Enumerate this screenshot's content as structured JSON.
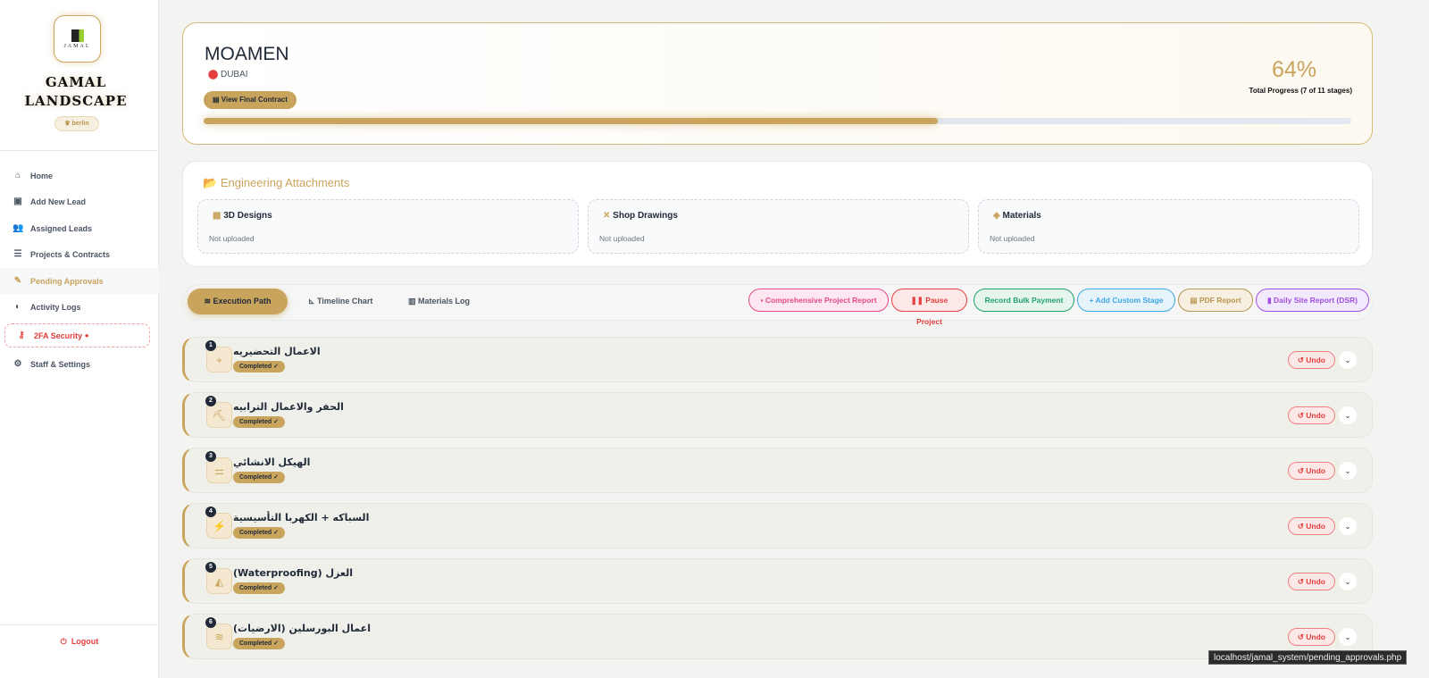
{
  "sidebar": {
    "logo_text": "JAMAL",
    "brand": "GAMAL LANDSCAPE",
    "user": "♛ berlin",
    "items": [
      {
        "label": "Home",
        "icon": "home-icon"
      },
      {
        "label": "Add New Lead",
        "icon": "contact-book-icon"
      },
      {
        "label": "Assigned Leads",
        "icon": "users-icon"
      },
      {
        "label": "Projects & Contracts",
        "icon": "list-check-icon"
      },
      {
        "label": "Pending Approvals",
        "icon": "file-signature-icon"
      },
      {
        "label": "Activity Logs",
        "icon": "shield-icon"
      },
      {
        "label": "2FA Security",
        "icon": "key-icon"
      },
      {
        "label": "Staff & Settings",
        "icon": "user-gear-icon"
      }
    ],
    "logout": "Logout"
  },
  "header": {
    "name": "MOAMEN",
    "location": "DUBAI",
    "view_contract": "View Final Contract",
    "progress_pct": "64%",
    "progress_value": 64,
    "progress_label": "Total Progress (7 of 11 stages)"
  },
  "attachments": {
    "title": "Engineering Attachments",
    "boxes": [
      {
        "title": "3D Designs",
        "status": "Not uploaded"
      },
      {
        "title": "Shop Drawings",
        "status": "Not uploaded"
      },
      {
        "title": "Materials",
        "status": "Not uploaded"
      }
    ]
  },
  "toolbar": {
    "tabs": [
      "Execution Path",
      "Timeline Chart",
      "Materials Log"
    ],
    "actions": [
      {
        "label": "Comprehensive Project Report",
        "color": "#e5488a"
      },
      {
        "label": "Pause Project",
        "color": "#e53e3e"
      },
      {
        "label": "Record Bulk Payment",
        "color": "#22a06b"
      },
      {
        "label": "+ Add Custom Stage",
        "color": "#3ea8e5"
      },
      {
        "label": "PDF Report",
        "color": "#b9954e"
      },
      {
        "label": "Daily Site Report (DSR)",
        "color": "#9f4fe0"
      }
    ]
  },
  "stages": [
    {
      "num": "1",
      "title": "الاعمال التحضيريه",
      "status": "Completed ✓",
      "undo": "Undo"
    },
    {
      "num": "2",
      "title": "الحفر والاعمال الترابيه",
      "status": "Completed ✓",
      "undo": "Undo"
    },
    {
      "num": "3",
      "title": "الهيكل الانشائي",
      "status": "Completed ✓",
      "undo": "Undo"
    },
    {
      "num": "4",
      "title": "السباكه + الكهربا التأسيسية",
      "status": "Completed ✓",
      "undo": "Undo"
    },
    {
      "num": "5",
      "title": "العزل (Waterproofing)",
      "status": "Completed ✓",
      "undo": "Undo"
    },
    {
      "num": "6",
      "title": "اعمال البورسلين (الارضيات)",
      "status": "Completed ✓",
      "undo": "Undo"
    }
  ],
  "status_url": "localhost/jamal_system/pending_approvals.php"
}
